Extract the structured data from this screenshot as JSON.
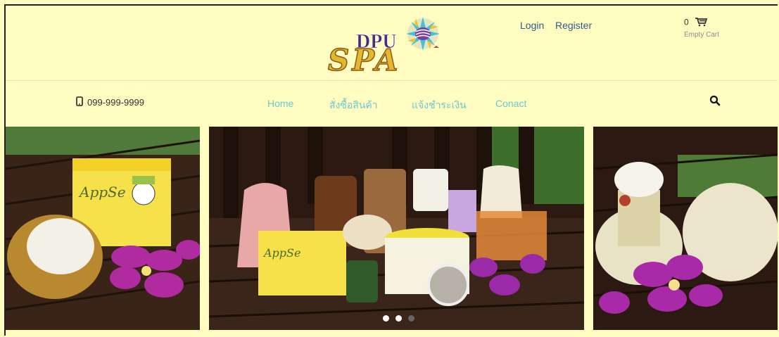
{
  "brand": {
    "logo_top": "DPU",
    "logo_bottom": "SPA"
  },
  "header": {
    "login": "Login",
    "register": "Register",
    "cart_count": "0",
    "cart_empty": "Empty Cart"
  },
  "nav": {
    "phone": "099-999-9999",
    "items": [
      {
        "label": "Home"
      },
      {
        "label": "สั่งซื้อสินค้า"
      },
      {
        "label": "แจ้งชำระเงิน"
      },
      {
        "label": "Conact"
      }
    ]
  },
  "carousel": {
    "slides": 3,
    "dots": 3,
    "active_dot": 1,
    "product_label": "AppSe"
  },
  "colors": {
    "background": "#fffcc2",
    "nav_link": "#6cc9cf",
    "auth_link": "#2e5d8a",
    "dark": "#222222"
  },
  "icons": {
    "phone": "phone-icon",
    "cart": "cart-icon",
    "search": "search-icon"
  }
}
